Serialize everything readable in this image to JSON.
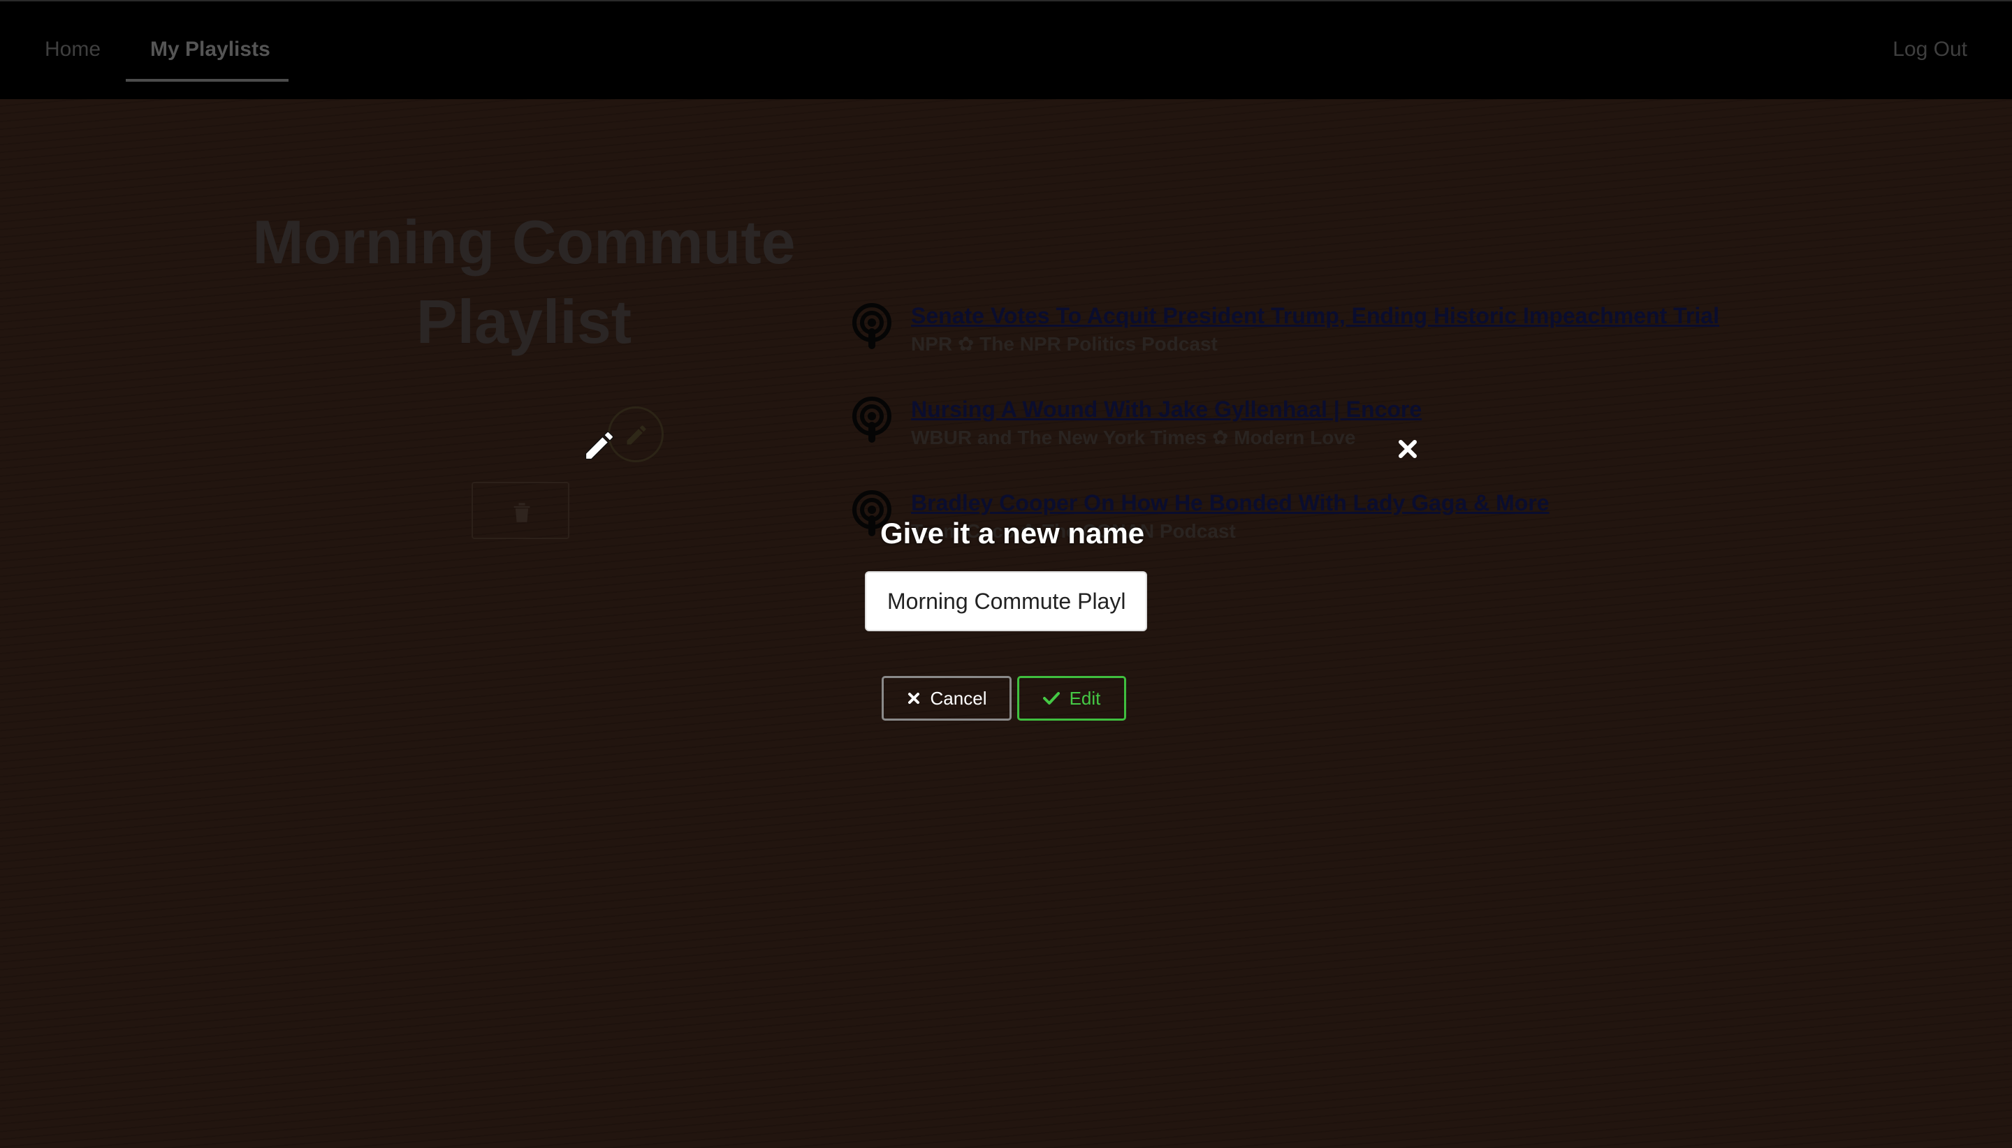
{
  "nav": {
    "home": "Home",
    "my_playlists": "My Playlists",
    "log_out": "Log Out"
  },
  "playlist": {
    "title": "Morning Commute Playlist"
  },
  "episodes": [
    {
      "title": "Senate Votes To Acquit President Trump, Ending Historic Impeachment Trial",
      "meta": "NPR ✿ The NPR Politics Podcast"
    },
    {
      "title": "Nursing A Wound With Jake Gyllenhaal | Encore",
      "meta": "WBUR and The New York Times ✿ Modern Love"
    },
    {
      "title": "Bradley Cooper On How He Bonded With Lady Gaga & More",
      "meta": "Team Coco ✿ The CONAN Podcast"
    }
  ],
  "modal": {
    "heading": "Give it a new name",
    "input_value": "Morning Commute Playlist",
    "cancel_label": "Cancel",
    "edit_label": "Edit"
  },
  "colors": {
    "accent_green": "#45c845",
    "background": "#1d130e"
  },
  "icons": {
    "close": "close-icon",
    "pencil": "pencil-icon",
    "trash": "trash-icon",
    "podcast": "podcast-icon",
    "check": "check-icon"
  }
}
